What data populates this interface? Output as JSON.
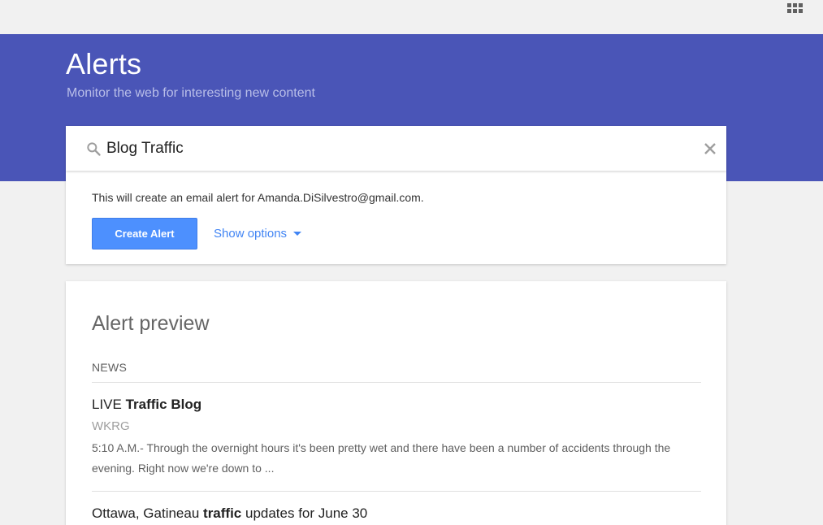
{
  "header": {
    "apps_icon": "apps-grid-icon"
  },
  "hero": {
    "title": "Alerts",
    "subtitle": "Monitor the web for interesting new content",
    "background_color": "#4a55b7"
  },
  "search": {
    "value": "Blog Traffic",
    "search_icon": "search-icon",
    "clear_icon": "close-icon"
  },
  "create": {
    "info_text": "This will create an email alert for Amanda.DiSilvestro@gmail.com.",
    "create_button_label": "Create Alert",
    "show_options_label": "Show options",
    "accent_color": "#4d90fe"
  },
  "preview": {
    "title": "Alert preview",
    "section_label": "NEWS",
    "items": [
      {
        "title_prefix": "LIVE ",
        "title_bold": "Traffic Blog",
        "title_suffix": "",
        "source": "WKRG",
        "snippet": "5:10 A.M.- Through the overnight hours it's been pretty wet and there have been a number of accidents through the evening. Right now we're down to ..."
      },
      {
        "title_prefix": "Ottawa, Gatineau ",
        "title_bold": "traffic",
        "title_suffix": " updates for June 30"
      }
    ]
  }
}
